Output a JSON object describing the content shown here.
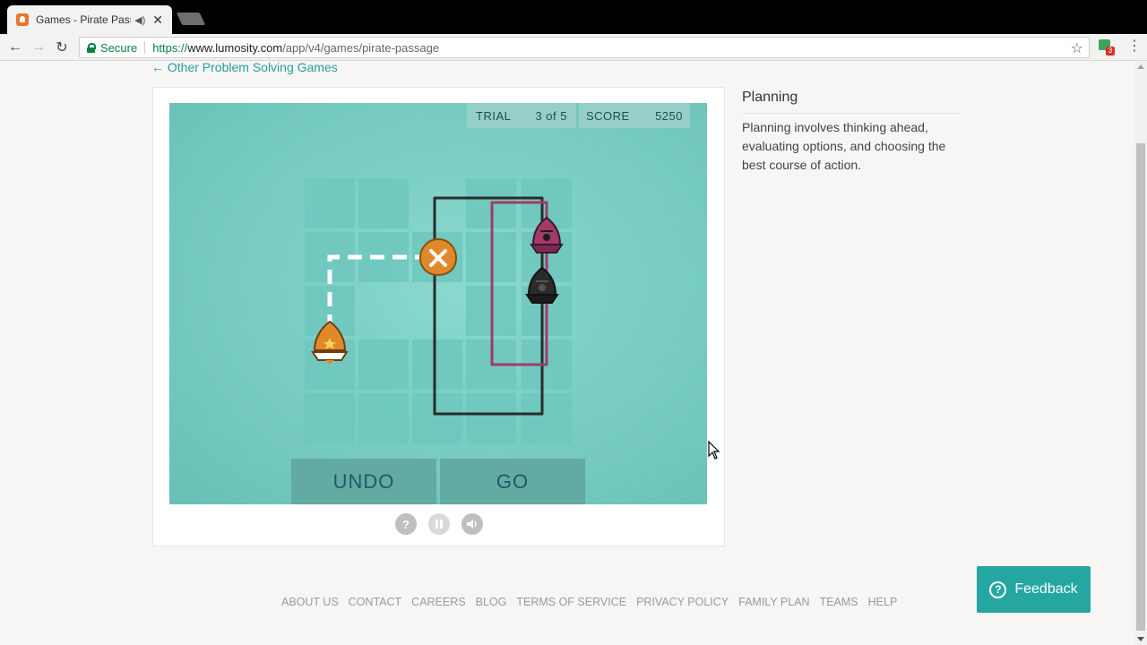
{
  "browser": {
    "tab_title": "Games - Pirate Passage",
    "tab_close": "✕",
    "secure_label": "Secure",
    "url_scheme": "https://",
    "url_host": "www.lumosity.com",
    "url_path": "/app/v4/games/pirate-passage",
    "extension_badge": "3"
  },
  "page": {
    "back_link": "← Other Problem Solving Games"
  },
  "game": {
    "trial_label": "TRIAL",
    "trial_value": "3 of 5",
    "score_label": "SCORE",
    "score_value": "5250",
    "undo_label": "UNDO",
    "go_label": "GO",
    "help_glyph": "?",
    "colors": {
      "water": "#7acec5",
      "tile": "#6ec7bd",
      "player_ship": "#e0892a",
      "pirate_magenta": "#a23a6a",
      "pirate_black": "#2b2b2b",
      "path_white": "#ffffff"
    }
  },
  "sidebar": {
    "title": "Planning",
    "description": "Planning involves thinking ahead, evaluating options, and choosing the best course of action."
  },
  "footer": {
    "links": [
      "ABOUT US",
      "CONTACT",
      "CAREERS",
      "BLOG",
      "TERMS OF SERVICE",
      "PRIVACY POLICY",
      "FAMILY PLAN",
      "TEAMS",
      "HELP"
    ]
  },
  "feedback": {
    "label": "Feedback",
    "icon_glyph": "?"
  }
}
